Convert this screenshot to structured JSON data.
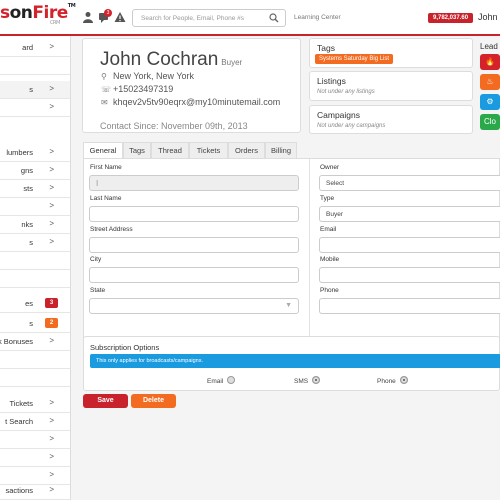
{
  "app": {
    "logo_red": "s",
    "logo_dark_a": "",
    "logo_on": "on",
    "logo_fire": "Fire",
    "logo_tm": "TM",
    "logo_sub": "CRM",
    "search_placeholder": "Search for People, Email, Phone #s",
    "learning_center": "Learning Center",
    "credits": "9,782,037.60",
    "user_name": "John C",
    "notification_count": "3"
  },
  "sidebar": {
    "items": [
      {
        "label": "ard",
        "chevron": ">",
        "count": "",
        "count_color": ""
      },
      {
        "label": "",
        "chevron": "",
        "count": "",
        "count_color": ""
      },
      {
        "label": "s",
        "chevron": ">",
        "count": "",
        "count_color": "",
        "active": true
      },
      {
        "label": "",
        "chevron": ">",
        "count": "",
        "count_color": ""
      },
      {
        "label": "lumbers",
        "chevron": ">",
        "count": "",
        "count_color": ""
      },
      {
        "label": "gns",
        "chevron": ">",
        "count": "",
        "count_color": ""
      },
      {
        "label": "sts",
        "chevron": ">",
        "count": "",
        "count_color": ""
      },
      {
        "label": "",
        "chevron": ">",
        "count": "",
        "count_color": ""
      },
      {
        "label": "nks",
        "chevron": ">",
        "count": "",
        "count_color": ""
      },
      {
        "label": "s",
        "chevron": ">",
        "count": "",
        "count_color": ""
      },
      {
        "label": "",
        "chevron": "",
        "count": "",
        "count_color": ""
      },
      {
        "label": "",
        "chevron": "",
        "count": "",
        "count_color": ""
      },
      {
        "label": "es",
        "chevron": "",
        "count": "3",
        "count_color": "#c8232c"
      },
      {
        "label": "s",
        "chevron": "",
        "count": "2",
        "count_color": "#f26b21"
      },
      {
        "label": "ck Bonuses",
        "chevron": ">",
        "count": "",
        "count_color": ""
      },
      {
        "label": "",
        "chevron": "",
        "count": "",
        "count_color": ""
      },
      {
        "label": "",
        "chevron": "",
        "count": "",
        "count_color": ""
      },
      {
        "label": "Tickets",
        "chevron": ">",
        "count": "",
        "count_color": ""
      },
      {
        "label": "t Search",
        "chevron": ">",
        "count": "",
        "count_color": ""
      },
      {
        "label": "",
        "chevron": ">",
        "count": "",
        "count_color": ""
      },
      {
        "label": "",
        "chevron": ">",
        "count": "",
        "count_color": ""
      },
      {
        "label": "",
        "chevron": ">",
        "count": "",
        "count_color": ""
      },
      {
        "label": "sactions",
        "chevron": ">",
        "count": "",
        "count_color": ""
      }
    ]
  },
  "contact": {
    "name": "John Cochran",
    "role": "Buyer",
    "location": "New York, New York",
    "phone": "+15023497319",
    "email": "khqev2v5tv90eqrx@my10minutemail.com",
    "since": "Contact Since: November 09th, 2013"
  },
  "tags": {
    "title": "Tags",
    "tag": "Systems Saturday Big List"
  },
  "listings": {
    "title": "Listings",
    "empty": "Not under any listings"
  },
  "campaigns": {
    "title": "Campaigns",
    "empty": "Not under any campaigns"
  },
  "lead": {
    "title": "Lead",
    "buttons": [
      "🔥",
      "♨",
      "⚙",
      "Clo"
    ],
    "colors": [
      "#d3222a",
      "#f26b21",
      "#1a9be0",
      "#2aa84a"
    ]
  },
  "tabs": [
    "General",
    "Tags",
    "Thread",
    "Tickets",
    "Orders",
    "Billing"
  ],
  "form": {
    "first_name_label": "First Name",
    "first_name_value": "",
    "last_name_label": "Last Name",
    "street_label": "Street Address",
    "city_label": "City",
    "state_label": "State",
    "owner_label": "Owner",
    "owner_value": "Select",
    "type_label": "Type",
    "type_value": "Buyer",
    "email_label": "Email",
    "mobile_label": "Mobile",
    "phone_label": "Phone"
  },
  "subscription": {
    "title": "Subscription Options",
    "info": "This only applies for broadcasts/campaigns.",
    "email": "Email",
    "sms": "SMS",
    "phone": "Phone"
  },
  "actions": {
    "save": "Save",
    "delete": "Delete"
  }
}
